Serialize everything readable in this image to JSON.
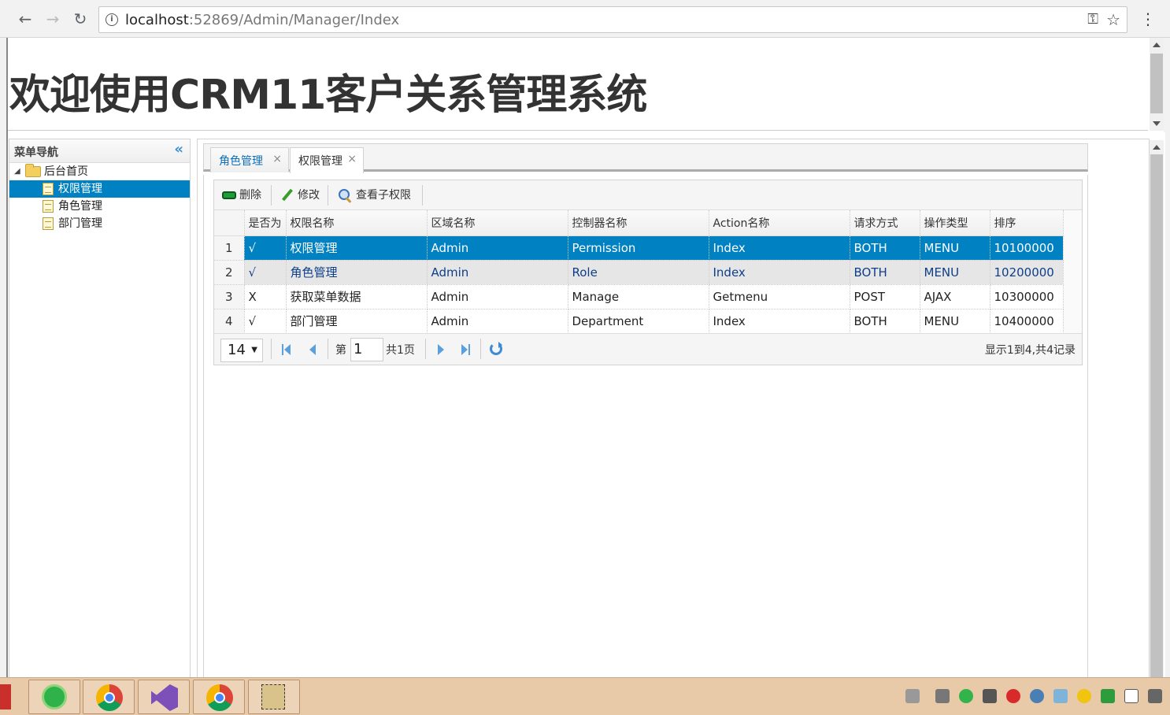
{
  "browser": {
    "url_host": "localhost",
    "url_rest": ":52869/Admin/Manager/Index"
  },
  "header": {
    "title": "欢迎使用CRM11客户关系管理系统"
  },
  "sidebar": {
    "title": "菜单导航",
    "collapse_glyph": "«",
    "root": "后台首页",
    "items": [
      {
        "label": "权限管理",
        "selected": true
      },
      {
        "label": "角色管理",
        "selected": false
      },
      {
        "label": "部门管理",
        "selected": false
      }
    ]
  },
  "tabs": [
    {
      "label": "角色管理",
      "active": false
    },
    {
      "label": "权限管理",
      "active": true
    }
  ],
  "toolbar": {
    "delete_label": "删除",
    "edit_label": "修改",
    "view_children_label": "查看子权限"
  },
  "grid": {
    "columns": [
      "是否为",
      "权限名称",
      "区域名称",
      "控制器名称",
      "Action名称",
      "请求方式",
      "操作类型",
      "排序"
    ],
    "rows": [
      {
        "n": "1",
        "cells": [
          "√",
          "权限管理",
          "Admin",
          "Permission",
          "Index",
          "BOTH",
          "MENU",
          "10100000"
        ],
        "state": "selected"
      },
      {
        "n": "2",
        "cells": [
          "√",
          "角色管理",
          "Admin",
          "Role",
          "Index",
          "BOTH",
          "MENU",
          "10200000"
        ],
        "state": "hover"
      },
      {
        "n": "3",
        "cells": [
          "X",
          "获取菜单数据",
          "Admin",
          "Manage",
          "Getmenu",
          "POST",
          "AJAX",
          "10300000"
        ],
        "state": "normal"
      },
      {
        "n": "4",
        "cells": [
          "√",
          "部门管理",
          "Admin",
          "Department",
          "Index",
          "BOTH",
          "MENU",
          "10400000"
        ],
        "state": "normal"
      }
    ]
  },
  "pager": {
    "page_size": "14",
    "page_prefix": "第",
    "page_value": "1",
    "page_total": "共1页",
    "info": "显示1到4,共4记录"
  },
  "colors": {
    "selection": "#0081c2",
    "tab_link": "#0e6eb8"
  }
}
